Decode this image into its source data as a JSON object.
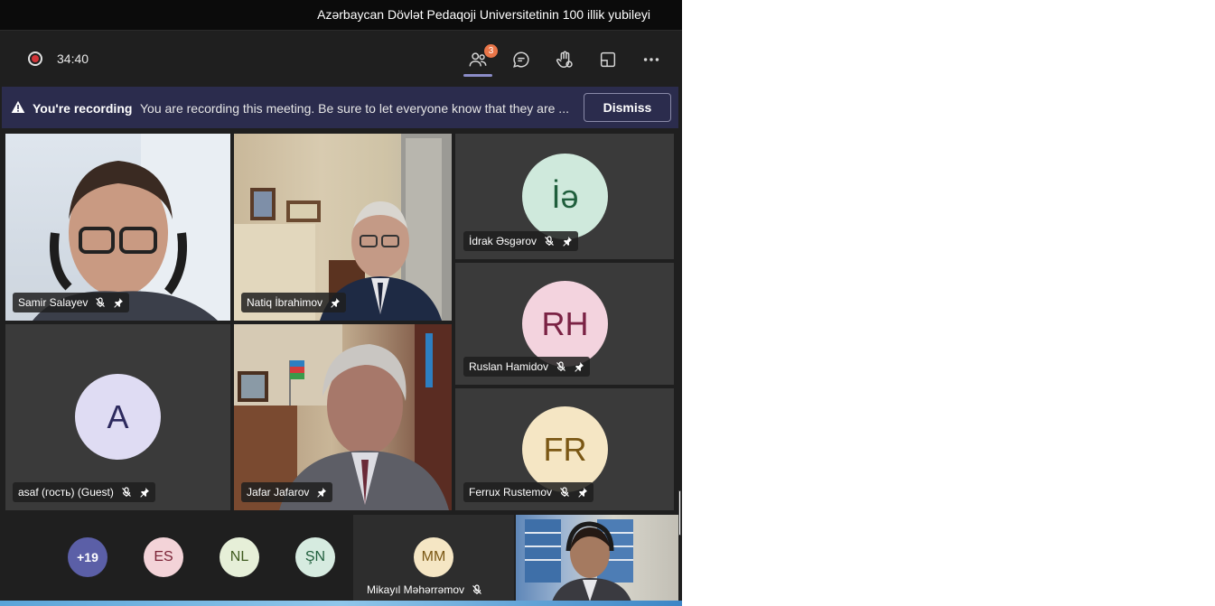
{
  "window": {
    "title": "Azərbaycan Dövlət Pedaqoji Universitetinin 100 illik yubileyi"
  },
  "controls": {
    "timer": "34:40",
    "participants_badge": "3",
    "icons": [
      "recording-icon",
      "people-icon",
      "chat-icon",
      "raise-hand-icon",
      "share-tray-icon",
      "more-options-icon"
    ]
  },
  "banner": {
    "title": "You're recording",
    "message": "You are recording this meeting. Be sure to let everyone know that they are ...",
    "dismiss_label": "Dismiss"
  },
  "tiles": {
    "samir": {
      "name": "Samir Salayev"
    },
    "natiq": {
      "name": "Natiq İbrahimov"
    },
    "idrak": {
      "name": "İdrak Əsgərov",
      "initials": "İƏ",
      "initials_display": "İə",
      "color": "#cfe9dc",
      "text_color": "#1f5e3c"
    },
    "ruslan": {
      "name": "Ruslan Hamidov",
      "initials": "RH",
      "color": "#f3d3de",
      "text_color": "#7a2244"
    },
    "asaf": {
      "name": "asaf (гость) (Guest)",
      "initials": "A",
      "color": "#dfdcf3",
      "text_color": "#2d2a5e"
    },
    "jafar": {
      "name": "Jafar Jafarov"
    },
    "ferrux": {
      "name": "Ferrux Rustemov",
      "initials": "FR",
      "color": "#f5e6c4",
      "text_color": "#7a5714"
    }
  },
  "strip": {
    "overflow": {
      "label": "+19",
      "color": "#5b5fa7"
    },
    "avatars": [
      {
        "initials": "ES",
        "color": "#f3d3d8",
        "text_color": "#7a2235"
      },
      {
        "initials": "NL",
        "color": "#e6efd8",
        "text_color": "#3f5a1f"
      },
      {
        "initials": "ŞN",
        "color": "#d6ebe0",
        "text_color": "#1f5e3c"
      }
    ],
    "featured": {
      "name": "Mikayıl Məhərrəmov",
      "initials": "MM",
      "color": "#f5e6c4",
      "text_color": "#7a5714"
    }
  }
}
